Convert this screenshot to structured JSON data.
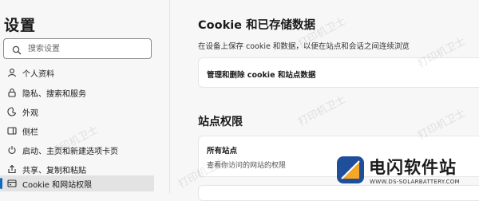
{
  "sidebar": {
    "title": "设置",
    "search_placeholder": "搜索设置",
    "items": [
      {
        "label": "个人资料",
        "icon": "profile-icon",
        "active": false
      },
      {
        "label": "隐私、搜索和服务",
        "icon": "lock-icon",
        "active": false
      },
      {
        "label": "外观",
        "icon": "appearance-icon",
        "active": false
      },
      {
        "label": "侧栏",
        "icon": "sidebar-panel-icon",
        "active": false
      },
      {
        "label": "启动、主页和新建选项卡页",
        "icon": "power-icon",
        "active": false
      },
      {
        "label": "共享、复制和粘贴",
        "icon": "share-icon",
        "active": false
      },
      {
        "label": "Cookie 和网站权限",
        "icon": "site-permissions-icon",
        "active": true
      }
    ]
  },
  "main": {
    "title": "Cookie 和已存储数据",
    "description": "在设备上保存 cookie 和数据，以便在站点和会话之间连续浏览",
    "manage_card": {
      "title": "管理和删除 cookie 和站点数据"
    },
    "permissions_title": "站点权限",
    "all_sites_card": {
      "title": "所有站点",
      "subtitle": "查看你访问的网站的权限"
    }
  },
  "watermark": "打印机卫士",
  "brand": {
    "name": "电闪软件站",
    "url": "WWW.DS-SOLARBATTERY.COM",
    "logo_colors": [
      "#1f4e9b",
      "#f5a623"
    ]
  },
  "colors": {
    "accent": "#0f6cbd"
  }
}
